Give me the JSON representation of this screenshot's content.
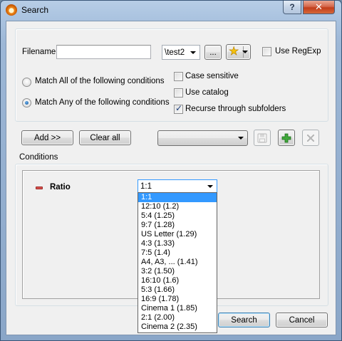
{
  "window": {
    "title": "Search",
    "help_label": "?",
    "close_label": "✕"
  },
  "search_panel": {
    "filename_label": "Filename",
    "filename_value": "",
    "path_value": "\\test2",
    "browse_label": "...",
    "regexp_label": "Use RegExp",
    "regexp_checked": false,
    "match_all_label": "Match All of the following conditions",
    "match_any_label": "Match Any of the following conditions",
    "match_selected": "any",
    "case_sensitive_label": "Case sensitive",
    "use_catalog_label": "Use catalog",
    "recurse_label": "Recurse through subfolders",
    "case_sensitive_checked": false,
    "use_catalog_checked": false,
    "recurse_checked": true
  },
  "toolbar": {
    "add_label": "Add >>",
    "clear_label": "Clear all",
    "preset_value": ""
  },
  "conditions": {
    "group_label": "Conditions",
    "row_label": "Ratio",
    "ratio_value": "1:1",
    "ratio_options": [
      "1:1",
      "12:10 (1.2)",
      "5:4 (1.25)",
      "9:7 (1.28)",
      "US Letter (1.29)",
      "4:3 (1.33)",
      "7:5 (1.4)",
      "A4, A3, ... (1.41)",
      "3:2 (1.50)",
      "16:10 (1.6)",
      "5:3 (1.66)",
      "16:9 (1.78)",
      "Cinema 1 (1.85)",
      "2:1 (2.00)",
      "Cinema 2 (2.35)"
    ],
    "ratio_highlighted": "1:1"
  },
  "footer": {
    "search_label": "Search",
    "cancel_label": "Cancel"
  },
  "colors": {
    "selection": "#3399ff",
    "remove_icon": "#d9534f",
    "add_icon": "#2e9e2e"
  }
}
